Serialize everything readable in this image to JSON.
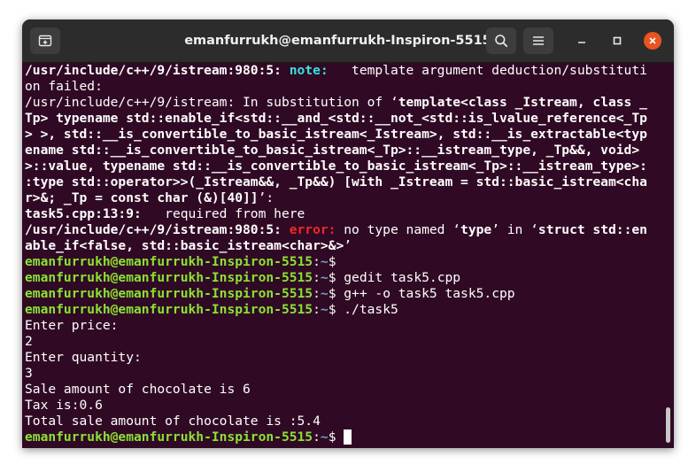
{
  "window": {
    "title": "emanfurrukh@emanfurrukh-Inspiron-5515: ~"
  },
  "icons": {
    "new_tab": "new-tab-icon",
    "search": "search-icon",
    "menu": "hamburger-menu-icon",
    "minimize": "minimize-icon",
    "maximize": "maximize-icon",
    "close": "close-icon"
  },
  "colors": {
    "terminal_bg": "#300a24",
    "titlebar_bg": "#2c2c2c",
    "prompt_user": "#8ae234",
    "prompt_path": "#729fcf",
    "note": "#34e2e2",
    "error": "#ef2929",
    "close_button": "#e95420"
  },
  "terminal": {
    "lines": [
      {
        "segments": [
          {
            "t": "/usr/include/c++/9/istream:980:5: ",
            "s": "b"
          },
          {
            "t": "note:",
            "s": "note"
          },
          {
            "t": "   template argument deduction/substituti",
            "s": ""
          }
        ]
      },
      {
        "segments": [
          {
            "t": "on failed:",
            "s": ""
          }
        ]
      },
      {
        "segments": [
          {
            "t": "/usr/include/c++/9/istream: In substitution of ‘",
            "s": ""
          },
          {
            "t": "template<class _Istream, class _",
            "s": "b"
          }
        ]
      },
      {
        "segments": [
          {
            "t": "Tp> typename std::enable_if<std::__and_<std::__not_<std::is_lvalue_reference<_Tp",
            "s": "b"
          }
        ]
      },
      {
        "segments": [
          {
            "t": "> >, std::__is_convertible_to_basic_istream<_Istream>, std::__is_extractable<typ",
            "s": "b"
          }
        ]
      },
      {
        "segments": [
          {
            "t": "ename std::__is_convertible_to_basic_istream<_Tp>::__istream_type, _Tp&&, void>",
            "s": "b"
          }
        ]
      },
      {
        "segments": [
          {
            "t": ">::value, typename std::__is_convertible_to_basic_istream<_Tp>::__istream_type>:",
            "s": "b"
          }
        ]
      },
      {
        "segments": [
          {
            "t": ":type std::operator>>(_Istream&&, _Tp&&) [with _Istream = std::basic_istream<cha",
            "s": "b"
          }
        ]
      },
      {
        "segments": [
          {
            "t": "r>&; _Tp = const char (&)[40]]",
            "s": "b"
          },
          {
            "t": "’:",
            "s": ""
          }
        ]
      },
      {
        "segments": [
          {
            "t": "task5.cpp:13:9:",
            "s": "b"
          },
          {
            "t": "   required from here",
            "s": ""
          }
        ]
      },
      {
        "segments": [
          {
            "t": "/usr/include/c++/9/istream:980:5: ",
            "s": "b"
          },
          {
            "t": "error:",
            "s": "err"
          },
          {
            "t": " no type named ‘",
            "s": ""
          },
          {
            "t": "type",
            "s": "b"
          },
          {
            "t": "’ in ‘",
            "s": ""
          },
          {
            "t": "struct std::en",
            "s": "b"
          }
        ]
      },
      {
        "segments": [
          {
            "t": "able_if<false, std::basic_istream<char>&>",
            "s": "b"
          },
          {
            "t": "’",
            "s": ""
          }
        ]
      },
      {
        "segments": [
          {
            "t": "emanfurrukh@emanfurrukh-Inspiron-5515",
            "s": "user"
          },
          {
            "t": ":",
            "s": ""
          },
          {
            "t": "~",
            "s": "path"
          },
          {
            "t": "$ ",
            "s": ""
          }
        ]
      },
      {
        "segments": [
          {
            "t": "emanfurrukh@emanfurrukh-Inspiron-5515",
            "s": "user"
          },
          {
            "t": ":",
            "s": ""
          },
          {
            "t": "~",
            "s": "path"
          },
          {
            "t": "$ gedit task5.cpp",
            "s": ""
          }
        ]
      },
      {
        "segments": [
          {
            "t": "emanfurrukh@emanfurrukh-Inspiron-5515",
            "s": "user"
          },
          {
            "t": ":",
            "s": ""
          },
          {
            "t": "~",
            "s": "path"
          },
          {
            "t": "$ g++ -o task5 task5.cpp",
            "s": ""
          }
        ]
      },
      {
        "segments": [
          {
            "t": "emanfurrukh@emanfurrukh-Inspiron-5515",
            "s": "user"
          },
          {
            "t": ":",
            "s": ""
          },
          {
            "t": "~",
            "s": "path"
          },
          {
            "t": "$ ./task5",
            "s": ""
          }
        ]
      },
      {
        "segments": [
          {
            "t": "Enter price:",
            "s": ""
          }
        ]
      },
      {
        "segments": [
          {
            "t": "2",
            "s": ""
          }
        ]
      },
      {
        "segments": [
          {
            "t": "Enter quantity:",
            "s": ""
          }
        ]
      },
      {
        "segments": [
          {
            "t": "3",
            "s": ""
          }
        ]
      },
      {
        "segments": [
          {
            "t": "Sale amount of chocolate is 6",
            "s": ""
          }
        ]
      },
      {
        "segments": [
          {
            "t": "Tax is:0.6",
            "s": ""
          }
        ]
      },
      {
        "segments": [
          {
            "t": "Total sale amount of chocolate is :5.4",
            "s": ""
          }
        ]
      },
      {
        "segments": [
          {
            "t": "emanfurrukh@emanfurrukh-Inspiron-5515",
            "s": "user"
          },
          {
            "t": ":",
            "s": ""
          },
          {
            "t": "~",
            "s": "path"
          },
          {
            "t": "$ ",
            "s": ""
          }
        ],
        "cursor": true
      }
    ]
  }
}
